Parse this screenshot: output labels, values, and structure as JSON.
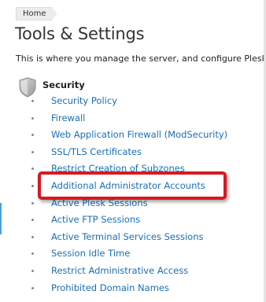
{
  "breadcrumb": {
    "home_label": "Home"
  },
  "page_title": "Tools & Settings",
  "intro_text": "This is where you manage the server, and configure Plesk, s",
  "security": {
    "title": "Security",
    "icon": "shield-icon",
    "items": [
      {
        "label": "Security Policy"
      },
      {
        "label": "Firewall"
      },
      {
        "label": "Web Application Firewall (ModSecurity)"
      },
      {
        "label": "SSL/TLS Certificates"
      },
      {
        "label": "Restrict Creation of Subzones"
      },
      {
        "label": "Additional Administrator Accounts",
        "highlighted": true
      },
      {
        "label": "Active Plesk Sessions"
      },
      {
        "label": "Active FTP Sessions"
      },
      {
        "label": "Active Terminal Services Sessions"
      },
      {
        "label": "Session Idle Time"
      },
      {
        "label": "Restrict Administrative Access"
      },
      {
        "label": "Prohibited Domain Names"
      }
    ]
  },
  "colors": {
    "link": "#1b6fb5",
    "highlight": "#d71920",
    "breadcrumb_bg": "#ececec"
  }
}
